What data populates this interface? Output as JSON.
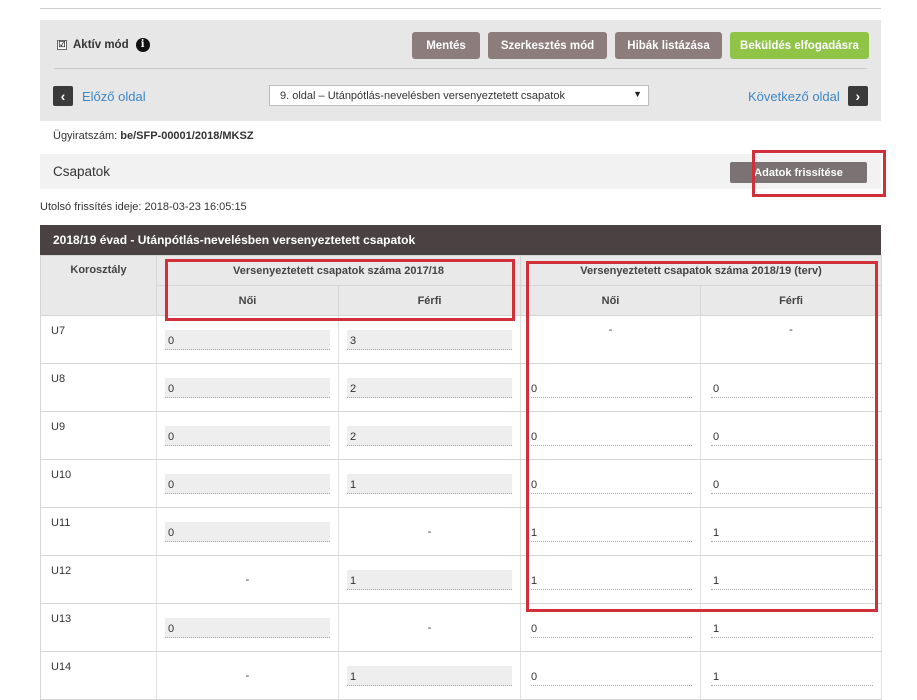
{
  "toolbar": {
    "aktiv_checkbox": "☑",
    "aktiv_label": "Aktív mód",
    "info_glyph": "i",
    "buttons": {
      "save": "Mentés",
      "edit_mode": "Szerkesztés mód",
      "errors": "Hibák listázása",
      "submit": "Beküldés elfogadásra"
    }
  },
  "nav": {
    "prev_icon": "‹",
    "prev": "Előző oldal",
    "page_select": "9. oldal – Utánpótlás-nevelésben versenyeztetett csapatok",
    "select_arrow": "▼",
    "next": "Következő oldal",
    "next_icon": "›"
  },
  "case": {
    "label": "Ügyiratszám:",
    "number": "be/SFP-00001/2018/MKSZ"
  },
  "section": {
    "title": "Csapatok",
    "refresh": "Adatok frissítése",
    "last_update": "Utolsó frissítés ideje: 2018-03-23 16:05:15"
  },
  "table": {
    "title": "2018/19 évad - Utánpótlás-nevelésben versenyeztetett csapatok",
    "col_age": "Korosztály",
    "group_2017": "Versenyeztetett csapatok száma 2017/18",
    "group_2018": "Versenyeztetett csapatok száma 2018/19 (terv)",
    "female": "Női",
    "male": "Férfi",
    "rows": [
      {
        "age": "U7",
        "f2017": "0",
        "m2017": "3",
        "f2018": "-",
        "m2018": "-"
      },
      {
        "age": "U8",
        "f2017": "0",
        "m2017": "2",
        "f2018": "0",
        "m2018": "0"
      },
      {
        "age": "U9",
        "f2017": "0",
        "m2017": "2",
        "f2018": "0",
        "m2018": "0"
      },
      {
        "age": "U10",
        "f2017": "0",
        "m2017": "1",
        "f2018": "0",
        "m2018": "0"
      },
      {
        "age": "U11",
        "f2017": "0",
        "m2017": "-",
        "f2018": "1",
        "m2018": "1"
      },
      {
        "age": "U12",
        "f2017": "-",
        "m2017": "1",
        "f2018": "1",
        "m2018": "1"
      },
      {
        "age": "U13",
        "f2017": "0",
        "m2017": "-",
        "f2018": "0",
        "m2018": "1"
      },
      {
        "age": "U14",
        "f2017": "-",
        "m2017": "1",
        "f2018": "0",
        "m2018": "1"
      }
    ]
  },
  "colors": {
    "highlight": "#d12f3a",
    "button_grey": "#8c7c7c",
    "button_green": "#8fc447",
    "link_blue": "#3d86c6",
    "table_header": "#4a4242"
  }
}
